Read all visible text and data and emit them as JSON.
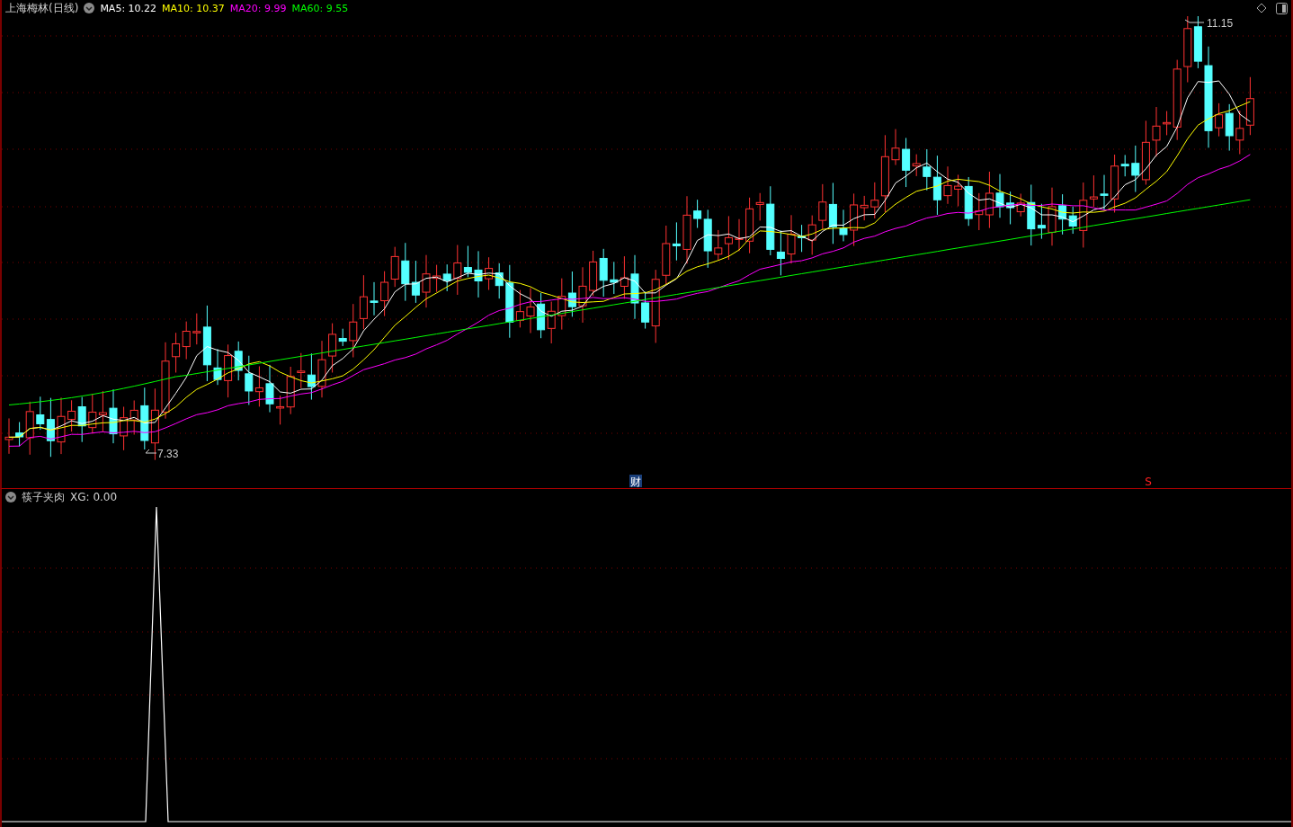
{
  "main_panel": {
    "title": "上海梅林(日线)",
    "indicators": [
      {
        "label": "MA5: 10.22",
        "color": "#ffffff"
      },
      {
        "label": "MA10: 10.37",
        "color": "#ffff00"
      },
      {
        "label": "MA20: 9.99",
        "color": "#ff00ff"
      },
      {
        "label": "MA60: 9.55",
        "color": "#00ff00"
      }
    ],
    "high_label": "11.15",
    "low_label": "7.33",
    "markers": [
      {
        "text": "财",
        "kind": "finance"
      },
      {
        "text": "S",
        "kind": "sell"
      }
    ]
  },
  "sub_panel": {
    "title": "筷子夹肉",
    "reading": "XG: 0.00"
  }
}
